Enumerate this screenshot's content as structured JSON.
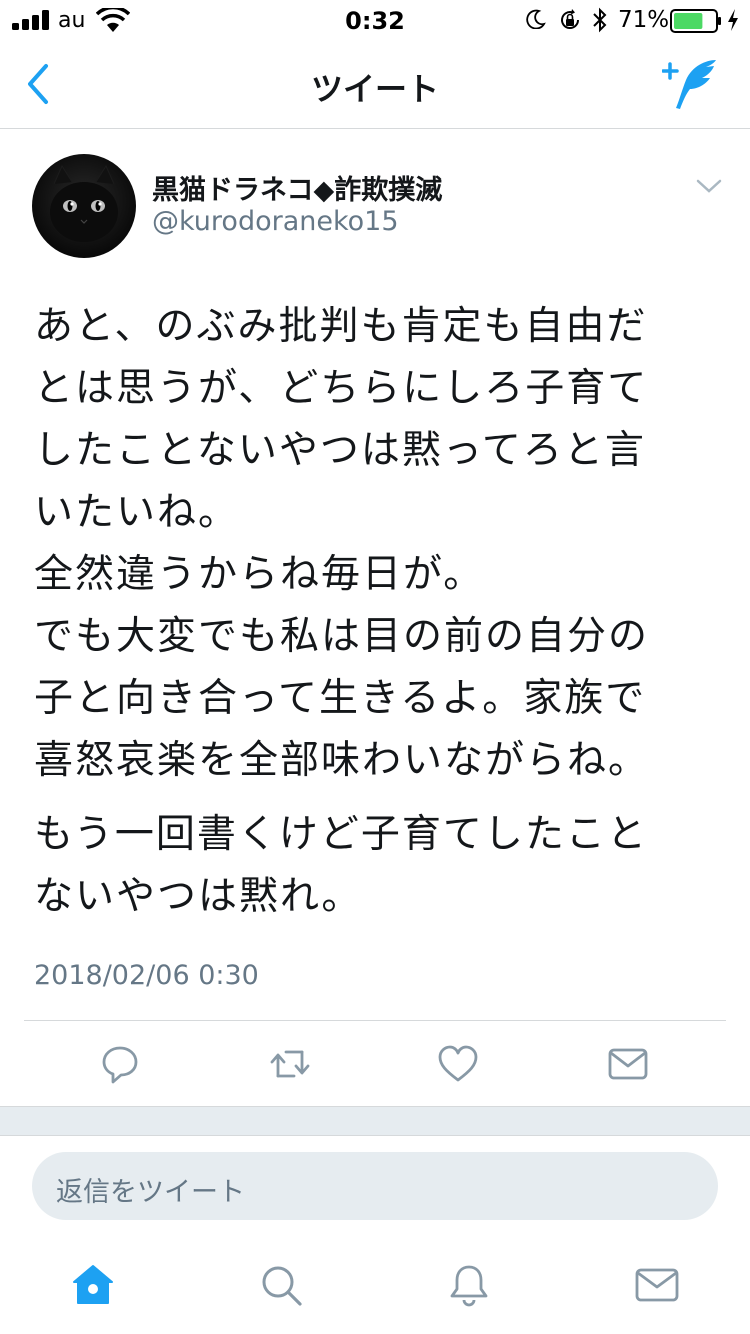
{
  "status_bar": {
    "carrier": "au",
    "time": "0:32",
    "battery_percent": "71%",
    "battery_level": 0.71,
    "icons": [
      "signal-icon",
      "wifi-icon",
      "moon-icon",
      "orientation-lock-icon",
      "bluetooth-icon",
      "battery-icon",
      "charging-icon"
    ]
  },
  "nav": {
    "title": "ツイート",
    "back_icon": "chevron-left-icon",
    "compose_icon": "compose-tweet-icon"
  },
  "tweet": {
    "display_name": "黒猫ドラネコ◆詐欺撲滅",
    "handle": "@kurodoraneko15",
    "body_lines": [
      "あと、のぶみ批判も肯定も自由だ",
      "とは思うが、どちらにしろ子育て",
      "したことないやつは黙ってろと言",
      "いたいね。",
      "全然違うからね毎日が。",
      "でも大変でも私は目の前の自分の",
      "子と向き合って生きるよ。家族で",
      "喜怒哀楽を全部味わいながらね。"
    ],
    "body_lines_2": [
      "もう一回書くけど子育てしたこと",
      "ないやつは黙れ。"
    ],
    "timestamp": "2018/02/06 0:30"
  },
  "actions": [
    "reply-icon",
    "retweet-icon",
    "like-icon",
    "direct-message-icon"
  ],
  "reply": {
    "placeholder": "返信をツイート"
  },
  "tabbar": {
    "items": [
      "home-icon",
      "search-icon",
      "notifications-icon",
      "messages-icon"
    ],
    "active": "home-icon"
  },
  "colors": {
    "accent": "#1da1f2",
    "text": "#14171a",
    "secondary_text": "#657786",
    "action_gray": "#8899a6",
    "divider": "#d6d9db",
    "battery_green": "#4cd964"
  }
}
